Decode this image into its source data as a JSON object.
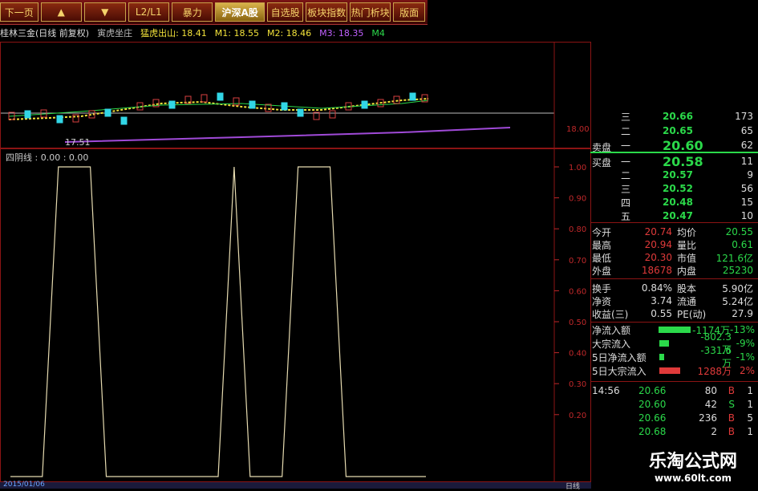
{
  "toolbar": {
    "items": [
      "下一页",
      "",
      "",
      "L2/L1",
      "暴力",
      "沪深A股",
      "自选股",
      "板块指数",
      "热门析块",
      "版面"
    ]
  },
  "infoline": {
    "stock": "桂林三金(日线 前复权)",
    "formula": "寅虎坐庄",
    "ma_label": "猛虎出山: 18.41",
    "m1": "M1: 18.55",
    "m2": "M2: 18.46",
    "m3": "M3: 18.35",
    "m4": "M4"
  },
  "upper_chart": {
    "low_marker": "17.51",
    "price_axis_label": "18.00",
    "colors": {
      "ma_yellow": "#f2e23a",
      "candle_up": "#d94040",
      "candle_down": "#32d6e6",
      "purple": "#a04ad8"
    }
  },
  "lower_chart": {
    "title": "四阴线 : 0.00 : 0.00",
    "y_ticks": [
      "1.00",
      "0.90",
      "0.80",
      "0.70",
      "0.60",
      "0.50",
      "0.40",
      "0.30",
      "0.20"
    ],
    "bottom_date": "2015/01/06",
    "bottom_right": "日线"
  },
  "chart_data": {
    "type": "line",
    "title": "四阴线 : 0.00 : 0.00",
    "ylim": [
      0,
      1
    ],
    "series": [
      {
        "values": [
          0,
          0,
          0,
          1,
          1,
          1,
          0,
          0,
          0,
          0,
          0,
          0,
          0,
          0,
          1,
          0,
          0,
          0,
          1,
          1,
          1,
          0,
          0,
          0,
          0,
          0,
          0
        ]
      }
    ]
  },
  "quote": {
    "sell": [
      {
        "label": "三",
        "price": "20.66",
        "vol": "173"
      },
      {
        "label": "二",
        "price": "20.65",
        "vol": "65"
      },
      {
        "label": "一",
        "price": "20.60",
        "vol": "62"
      }
    ],
    "sell_head": "卖盘",
    "buy_head": "买盘",
    "buy": [
      {
        "label": "一",
        "price": "20.58",
        "vol": "11"
      },
      {
        "label": "二",
        "price": "20.57",
        "vol": "9"
      },
      {
        "label": "三",
        "price": "20.52",
        "vol": "56"
      },
      {
        "label": "四",
        "price": "20.48",
        "vol": "15"
      },
      {
        "label": "五",
        "price": "20.47",
        "vol": "10"
      }
    ],
    "stats": [
      {
        "k1": "今开",
        "v1": "20.74",
        "k2": "均价",
        "v2": "20.55"
      },
      {
        "k1": "最高",
        "v1": "20.94",
        "k2": "量比",
        "v2": "0.61"
      },
      {
        "k1": "最低",
        "v1": "20.30",
        "k2": "市值",
        "v2": "121.6亿"
      },
      {
        "k1": "外盘",
        "v1": "18678",
        "k2": "内盘",
        "v2": "25230"
      }
    ],
    "fund": [
      {
        "k1": "换手",
        "v1": "0.84%",
        "k2": "股本",
        "v2": "5.90亿"
      },
      {
        "k1": "净资",
        "v1": "3.74",
        "k2": "流通",
        "v2": "5.24亿"
      },
      {
        "k1": "收益(三)",
        "v1": "0.55",
        "k2": "PE(动)",
        "v2": "27.9"
      }
    ],
    "flow": [
      {
        "k": "净流入额",
        "v": "-1174万",
        "p": "-13%"
      },
      {
        "k": "大宗流入",
        "v": "-802.3万",
        "p": "-9%"
      },
      {
        "k": "5日净流入额",
        "v": "-331.6万",
        "p": "-1%"
      },
      {
        "k": "5日大宗流入",
        "v": "1288万",
        "p": "2%"
      }
    ],
    "ticks": [
      {
        "t": "14:56",
        "p": "20.66",
        "v": "80",
        "s": "B",
        "n": "1"
      },
      {
        "t": "",
        "p": "20.60",
        "v": "42",
        "s": "S",
        "n": "1"
      },
      {
        "t": "",
        "p": "20.66",
        "v": "236",
        "s": "B",
        "n": "5"
      },
      {
        "t": "",
        "p": "20.68",
        "v": "2",
        "s": "B",
        "n": "1"
      }
    ]
  },
  "watermark": {
    "line1": "乐淘公式网",
    "line2": "www.60lt.com"
  }
}
